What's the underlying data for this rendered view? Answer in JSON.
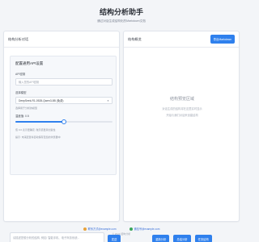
{
  "header": {
    "title": "结构分析助手",
    "subtitle": "通过对话生成结构化的Markdown文档"
  },
  "left_panel": {
    "title": "结构分析对话",
    "config": {
      "title": "配置通用API设置",
      "api_key_label": "API密钥",
      "api_key_placeholder": "输入您的API密钥",
      "model_label": "选择模型",
      "model_value": "DeepSeek-R1-0528-Qwen3-8B (免费)",
      "model_hint": "选择用于分析的模型",
      "temperature_label": "温度值: 0.5",
      "temperature_level": 0.5,
      "hint_1": "值 0.0 表示更确定, 较高值更具创造性",
      "hint_2": "提示: 未来配置将自动保存至您的浏览器中"
    },
    "chat_placeholder": "请描述您想分析的结构, 例如: 智能手机、电子商务系统...",
    "send_label": "发送"
  },
  "right_panel": {
    "title": "结构概览",
    "export_label": "导出Markdown",
    "empty_title": "结构预览区域",
    "empty_line_1": "对话生成的结构将在这里实时显示",
    "empty_line_2": "开始与我们对话来创建结构",
    "actions": [
      "重新分析",
      "总结分析",
      "任务结构"
    ]
  },
  "footer": {
    "link_1": "联系方式@example.com",
    "link_2": "微信号@example.com",
    "copyright": "© 2024 结构分析"
  },
  "colors": {
    "accent": "#2f80ed",
    "footer_link": "#3a6fd8"
  }
}
